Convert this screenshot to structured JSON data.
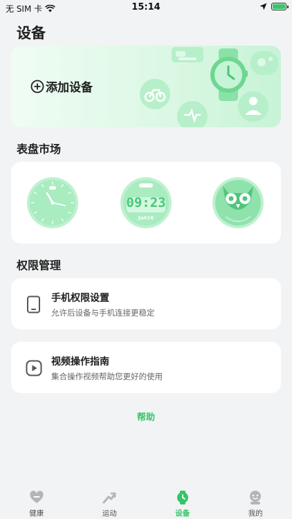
{
  "status_bar": {
    "carrier": "无 SIM 卡",
    "time": "15:14"
  },
  "page": {
    "title": "设备"
  },
  "add_device": {
    "label": "添加设备"
  },
  "dial_market": {
    "title": "表盘市场",
    "digital_face": {
      "time": "09:23",
      "date": "Jun16"
    }
  },
  "permissions": {
    "title": "权限管理",
    "items": [
      {
        "title": "手机权限设置",
        "desc": "允许后设备与手机连接更稳定",
        "icon": "phone-icon"
      },
      {
        "title": "视频操作指南",
        "desc": "集合操作视频帮助您更好的使用",
        "icon": "play-icon"
      }
    ]
  },
  "help": {
    "label": "帮助"
  },
  "tab_bar": {
    "tabs": [
      {
        "label": "健康",
        "icon": "heart-icon",
        "active": false
      },
      {
        "label": "运动",
        "icon": "run-icon",
        "active": false
      },
      {
        "label": "设备",
        "icon": "watch-icon",
        "active": true
      },
      {
        "label": "我的",
        "icon": "profile-icon",
        "active": false
      }
    ]
  },
  "colors": {
    "accent": "#35c468",
    "background": "#f2f3f5",
    "card": "#ffffff"
  }
}
